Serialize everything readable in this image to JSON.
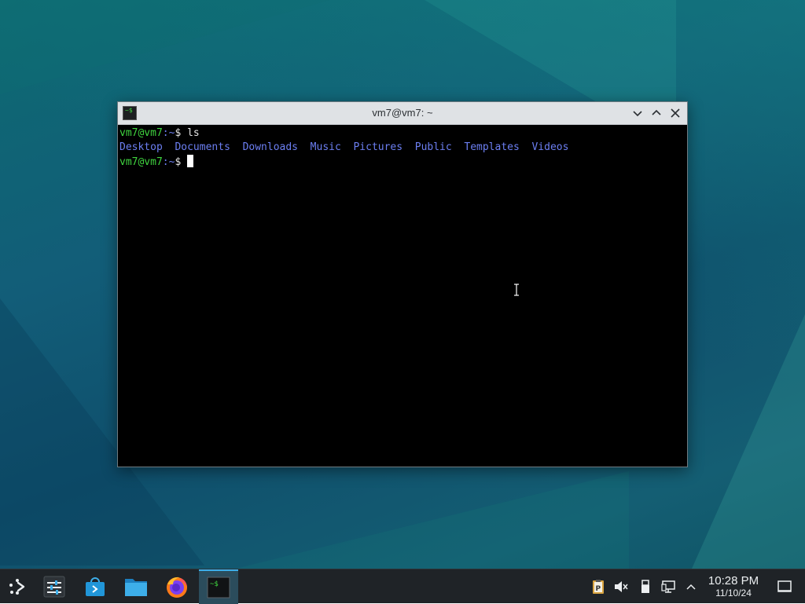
{
  "window": {
    "title": "vm7@vm7: ~",
    "icon_text": "~$"
  },
  "terminal": {
    "line1": {
      "user": "vm7@vm7",
      "path": ":~",
      "symbol": "$",
      "command": " ls"
    },
    "dirs": [
      "Desktop",
      "Documents",
      "Downloads",
      "Music",
      "Pictures",
      "Public",
      "Templates",
      "Videos"
    ],
    "line3": {
      "user": "vm7@vm7",
      "path": ":~",
      "symbol": "$ "
    }
  },
  "taskbar": {
    "launcher": "application-launcher-icon",
    "pinned": [
      "system-settings-icon",
      "discover-store-icon",
      "file-manager-icon",
      "firefox-icon",
      "terminal-icon"
    ],
    "terminal_icon_text": "~$",
    "tray": [
      "clipboard-icon",
      "volume-muted-icon",
      "usb-device-icon",
      "network-icon",
      "expand-tray-icon"
    ],
    "clock_time": "10:28 PM",
    "clock_date": "11/10/24",
    "show_desktop": "show-desktop-icon"
  },
  "colors": {
    "prompt_user": "#3fd43f",
    "prompt_path": "#6c7ff2",
    "directory": "#6c7ff2",
    "taskbar_bg": "#1f2327",
    "active_task_accent": "#3daee9"
  }
}
